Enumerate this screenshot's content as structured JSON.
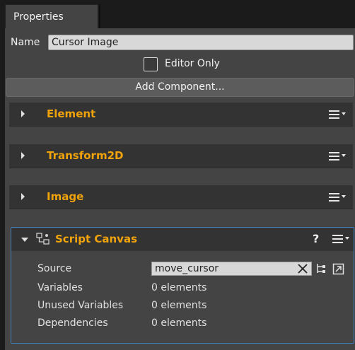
{
  "tab": {
    "label": "Properties"
  },
  "entity": {
    "name_label": "Name",
    "name_value": "Cursor Image"
  },
  "editor_only": {
    "label": "Editor Only",
    "checked": false
  },
  "add_component": {
    "label": "Add Component..."
  },
  "components": [
    {
      "title": "Element"
    },
    {
      "title": "Transform2D"
    },
    {
      "title": "Image"
    }
  ],
  "script_canvas": {
    "title": "Script Canvas",
    "help": "?",
    "source_label": "Source",
    "source_value": "move_cursor",
    "variables_label": "Variables",
    "variables_value": "0 elements",
    "unused_label": "Unused Variables",
    "unused_value": "0 elements",
    "dependencies_label": "Dependencies",
    "dependencies_value": "0 elements"
  },
  "colors": {
    "accent_title": "#f0a30a",
    "selection_border": "#3f7fbf",
    "panel_bg": "#444444",
    "header_bg": "#333333"
  }
}
